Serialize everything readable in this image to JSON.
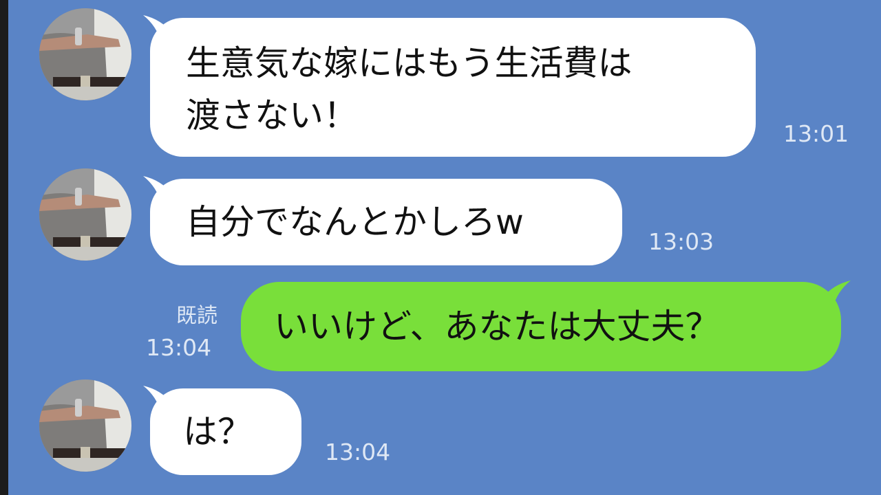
{
  "chat": {
    "messages": [
      {
        "direction": "incoming",
        "lines": [
          "生意気な嫁にはもう生活費は",
          "渡さない！"
        ],
        "time": "13:01"
      },
      {
        "direction": "incoming",
        "lines": [
          "自分でなんとかしろw"
        ],
        "time": "13:03"
      },
      {
        "direction": "outgoing",
        "lines": [
          "いいけど、あなたは大丈夫？"
        ],
        "time": "13:04",
        "read_label": "既読"
      },
      {
        "direction": "incoming",
        "lines": [
          "は？"
        ],
        "time": "13:04"
      }
    ]
  },
  "colors": {
    "background": "#5a84c6",
    "incoming_bubble": "#ffffff",
    "outgoing_bubble": "#79df3a",
    "meta_text": "#dfe8f5"
  },
  "icons": {
    "avatar": "sender-avatar-photo"
  }
}
